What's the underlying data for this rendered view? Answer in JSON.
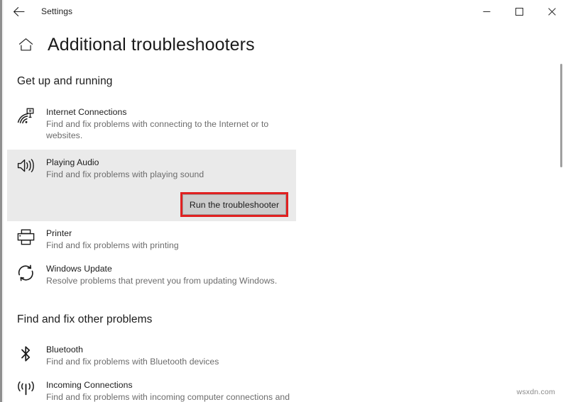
{
  "window": {
    "app_title": "Settings",
    "back_label": "Back",
    "minimize_label": "Minimize",
    "maximize_label": "Maximize",
    "close_label": "Close"
  },
  "header": {
    "home_icon": "home-icon",
    "page_title": "Additional troubleshooters"
  },
  "sections": [
    {
      "heading": "Get up and running",
      "items": [
        {
          "icon": "internet-connections-icon",
          "name": "Internet Connections",
          "desc": "Find and fix problems with connecting to the Internet or to websites.",
          "selected": false
        },
        {
          "icon": "playing-audio-icon",
          "name": "Playing Audio",
          "desc": "Find and fix problems with playing sound",
          "selected": true,
          "action_button": "Run the troubleshooter"
        },
        {
          "icon": "printer-icon",
          "name": "Printer",
          "desc": "Find and fix problems with printing",
          "selected": false
        },
        {
          "icon": "windows-update-icon",
          "name": "Windows Update",
          "desc": "Resolve problems that prevent you from updating Windows.",
          "selected": false
        }
      ]
    },
    {
      "heading": "Find and fix other problems",
      "items": [
        {
          "icon": "bluetooth-icon",
          "name": "Bluetooth",
          "desc": "Find and fix problems with Bluetooth devices",
          "selected": false
        },
        {
          "icon": "incoming-connections-icon",
          "name": "Incoming Connections",
          "desc": "Find and fix problems with incoming computer connections and",
          "selected": false
        }
      ]
    }
  ],
  "annotation": {
    "highlight_color": "#e02020",
    "target": "Run the troubleshooter"
  },
  "watermark": "wsxdn.com"
}
